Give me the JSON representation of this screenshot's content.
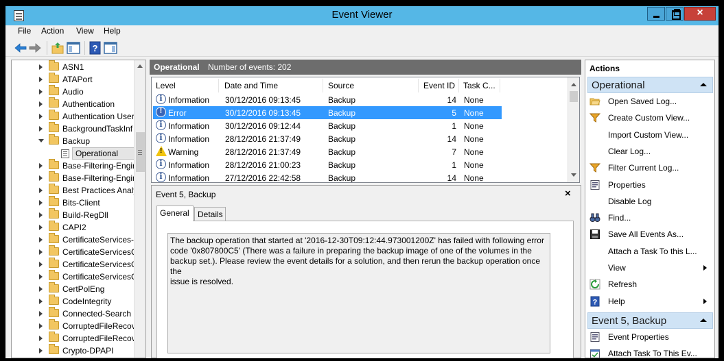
{
  "window": {
    "title": "Event Viewer",
    "close_glyph": "×"
  },
  "menu": [
    "File",
    "Action",
    "View",
    "Help"
  ],
  "toolbar": {
    "icons": [
      "back-arrow-icon",
      "forward-arrow-icon",
      "up-folder-icon",
      "show-hide-console-tree-icon",
      "help-icon",
      "show-action-pane-icon"
    ]
  },
  "tree": {
    "items": [
      {
        "label": "ASN1",
        "expanded": false
      },
      {
        "label": "ATAPort",
        "expanded": false
      },
      {
        "label": "Audio",
        "expanded": false
      },
      {
        "label": "Authentication",
        "expanded": false
      },
      {
        "label": "Authentication User",
        "expanded": false
      },
      {
        "label": "BackgroundTaskInf",
        "expanded": false
      },
      {
        "label": "Backup",
        "expanded": true
      },
      {
        "label": "Operational",
        "selected": true
      },
      {
        "label": "Base-Filtering-Engir",
        "expanded": false
      },
      {
        "label": "Base-Filtering-Engir",
        "expanded": false
      },
      {
        "label": "Best Practices Analy",
        "expanded": false
      },
      {
        "label": "Bits-Client",
        "expanded": false
      },
      {
        "label": "Build-RegDll",
        "expanded": false
      },
      {
        "label": "CAPI2",
        "expanded": false
      },
      {
        "label": "CertificateServices-I",
        "expanded": false
      },
      {
        "label": "CertificateServicesC",
        "expanded": false
      },
      {
        "label": "CertificateServicesC",
        "expanded": false
      },
      {
        "label": "CertificateServicesC",
        "expanded": false
      },
      {
        "label": "CertPolEng",
        "expanded": false
      },
      {
        "label": "CodeIntegrity",
        "expanded": false
      },
      {
        "label": "Connected-Search",
        "expanded": false
      },
      {
        "label": "CorruptedFileRecov",
        "expanded": false
      },
      {
        "label": "CorruptedFileRecov",
        "expanded": false
      },
      {
        "label": "Crypto-DPAPI",
        "expanded": false
      }
    ]
  },
  "log_header": {
    "name": "Operational",
    "count_text": "Number of events: 202"
  },
  "events": {
    "columns": [
      "Level",
      "Date and Time",
      "Source",
      "Event ID",
      "Task C..."
    ],
    "rows": [
      {
        "level": "Information",
        "icon": "info",
        "datetime": "30/12/2016 09:13:45",
        "source": "Backup",
        "event_id": "14",
        "task": "None",
        "selected": false
      },
      {
        "level": "Error",
        "icon": "error",
        "datetime": "30/12/2016 09:13:45",
        "source": "Backup",
        "event_id": "5",
        "task": "None",
        "selected": true
      },
      {
        "level": "Information",
        "icon": "info",
        "datetime": "30/12/2016 09:12:44",
        "source": "Backup",
        "event_id": "1",
        "task": "None",
        "selected": false
      },
      {
        "level": "Information",
        "icon": "info",
        "datetime": "28/12/2016 21:37:49",
        "source": "Backup",
        "event_id": "14",
        "task": "None",
        "selected": false
      },
      {
        "level": "Warning",
        "icon": "warning",
        "datetime": "28/12/2016 21:37:49",
        "source": "Backup",
        "event_id": "7",
        "task": "None",
        "selected": false
      },
      {
        "level": "Information",
        "icon": "info",
        "datetime": "28/12/2016 21:00:23",
        "source": "Backup",
        "event_id": "1",
        "task": "None",
        "selected": false
      },
      {
        "level": "Information",
        "icon": "info",
        "datetime": "27/12/2016 22:42:58",
        "source": "Backup",
        "event_id": "14",
        "task": "None",
        "selected": false
      }
    ]
  },
  "detail": {
    "title": "Event 5, Backup",
    "close_glyph": "×",
    "tabs": [
      "General",
      "Details"
    ],
    "active_tab": "General",
    "message_lines": [
      "The backup operation that started at '2016-12-30T09:12:44.973001200Z' has failed with following error",
      "code '0x807800C5' (There was a failure in preparing the backup image of one of the volumes in the",
      "backup set.). Please review the event details for a solution, and then rerun the backup operation once the",
      "issue is resolved."
    ]
  },
  "actions": {
    "title": "Actions",
    "sections": [
      {
        "title": "Operational",
        "items": [
          {
            "label": "Open Saved Log...",
            "icon": "open-folder-icon"
          },
          {
            "label": "Create Custom View...",
            "icon": "filter-funnel-icon"
          },
          {
            "label": "Import Custom View...",
            "icon": ""
          },
          {
            "label": "Clear Log...",
            "icon": ""
          },
          {
            "label": "Filter Current Log...",
            "icon": "filter-funnel-icon"
          },
          {
            "label": "Properties",
            "icon": "properties-icon"
          },
          {
            "label": "Disable Log",
            "icon": ""
          },
          {
            "label": "Find...",
            "icon": "binoculars-icon"
          },
          {
            "label": "Save All Events As...",
            "icon": "save-disk-icon"
          },
          {
            "label": "Attach a Task To this L...",
            "icon": ""
          },
          {
            "label": "View",
            "icon": "",
            "submenu": true
          },
          {
            "label": "Refresh",
            "icon": "refresh-icon"
          },
          {
            "label": "Help",
            "icon": "help-icon",
            "submenu": true
          }
        ]
      },
      {
        "title": "Event 5, Backup",
        "items": [
          {
            "label": "Event Properties",
            "icon": "properties-icon"
          },
          {
            "label": "Attach Task To This Ev...",
            "icon": "task-icon"
          }
        ]
      }
    ]
  },
  "colors": {
    "titlebar": "#55b7e6",
    "selection": "#3399ff",
    "pane_header": "#6d6d6d",
    "action_section": "#cfe3f5"
  }
}
